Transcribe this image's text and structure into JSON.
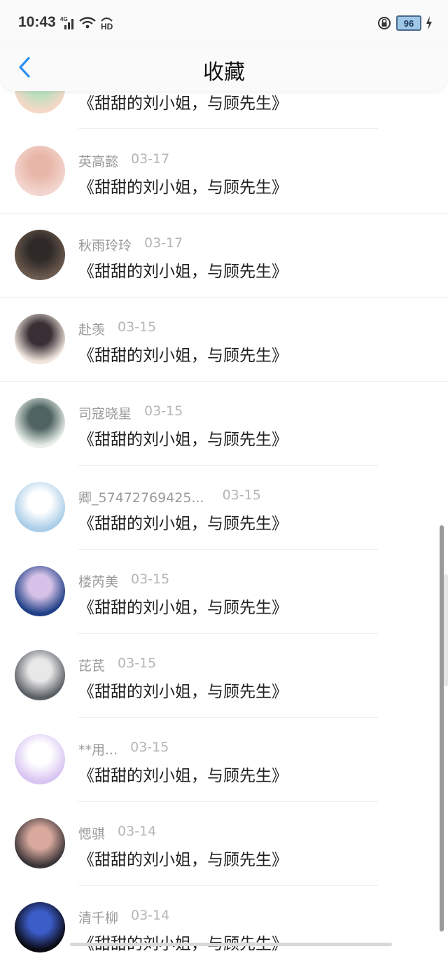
{
  "status_bar": {
    "time": "10:43",
    "network": "4G",
    "wifi_label": "HD",
    "battery": "96"
  },
  "nav": {
    "title": "收藏"
  },
  "items": [
    {
      "user": "",
      "date": "",
      "title": "《甜甜的刘小姐，与顾先生》",
      "avatar_colors": [
        "#f4d8c4",
        "#b9e0c0"
      ]
    },
    {
      "user": "英高懿",
      "date": "03-17",
      "title": "《甜甜的刘小姐，与顾先生》",
      "avatar_colors": [
        "#f3d6cf",
        "#e8b7a9"
      ]
    },
    {
      "user": "秋雨玲玲",
      "date": "03-17",
      "title": "《甜甜的刘小姐，与顾先生》",
      "avatar_colors": [
        "#6b5a4e",
        "#2f2a28"
      ]
    },
    {
      "user": "赴羡",
      "date": "03-15",
      "title": "《甜甜的刘小姐，与顾先生》",
      "avatar_colors": [
        "#efe5dc",
        "#3a2f35"
      ]
    },
    {
      "user": "司寇晓星",
      "date": "03-15",
      "title": "《甜甜的刘小姐，与顾先生》",
      "avatar_colors": [
        "#e9efe9",
        "#4f6462"
      ]
    },
    {
      "user": "卿_57472769425...",
      "date": "03-15",
      "title": "《甜甜的刘小姐，与顾先生》",
      "avatar_colors": [
        "#a9cde8",
        "#ffffff"
      ]
    },
    {
      "user": "楼芮美",
      "date": "03-15",
      "title": "《甜甜的刘小姐，与顾先生》",
      "avatar_colors": [
        "#1f3f86",
        "#d6c2e8"
      ]
    },
    {
      "user": "芘芪",
      "date": "03-15",
      "title": "《甜甜的刘小姐，与顾先生》",
      "avatar_colors": [
        "#5a5f66",
        "#e8e8e8"
      ]
    },
    {
      "user": "**用...",
      "date": "03-15",
      "title": "《甜甜的刘小姐，与顾先生》",
      "avatar_colors": [
        "#d8c4f2",
        "#ffffff"
      ]
    },
    {
      "user": "愢骐",
      "date": "03-14",
      "title": "《甜甜的刘小姐，与顾先生》",
      "avatar_colors": [
        "#3a3438",
        "#d9a99d"
      ]
    },
    {
      "user": "清千柳",
      "date": "03-14",
      "title": "《甜甜的刘小姐，与顾先生》",
      "avatar_colors": [
        "#0a0a12",
        "#3c5cc8"
      ]
    }
  ]
}
